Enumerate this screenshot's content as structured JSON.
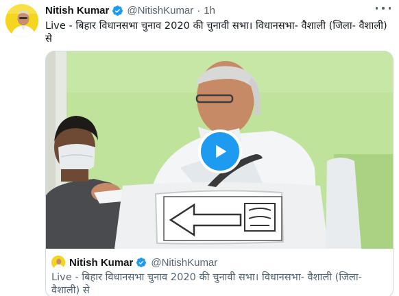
{
  "tweet": {
    "author_name": "Nitish Kumar",
    "author_handle": "@NitishKumar",
    "separator": "·",
    "time": "1h",
    "text": "Live - बिहार विधानसभा चुनाव 2020 की चुनावी सभा। विधानसभा- वैशाली (जिला- वैशाली) से",
    "avatar_icon": "profile-avatar",
    "verified_icon": "verified-badge-icon",
    "more_icon": "more-options-icon"
  },
  "video": {
    "play_icon": "play-icon"
  },
  "quoted": {
    "author_name": "Nitish Kumar",
    "author_handle": "@NitishKumar",
    "text": "Live - बिहार विधानसभा चुनाव 2020 की चुनावी सभा। विधानसभा- वैशाली (जिला- वैशाली) से"
  },
  "colors": {
    "accent": "#1d9bf0",
    "text_primary": "#0f1419",
    "text_secondary": "#536471",
    "border": "#cfd9de"
  }
}
